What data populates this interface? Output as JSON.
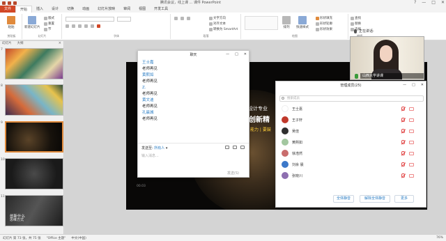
{
  "titlebar": {
    "title": "腾讯会议，线上课 ... 课件 PowerPoint",
    "controls": [
      "?",
      "—",
      "□",
      "✕"
    ]
  },
  "ribbon_tabs": [
    "文件",
    "开始",
    "插入",
    "设计",
    "切换",
    "动画",
    "幻灯片放映",
    "审阅",
    "视图",
    "开发工具"
  ],
  "ribbon": {
    "paste": "粘贴",
    "new_slide": "新建幻灯片",
    "layout": "版式",
    "reset": "重置",
    "section": "节",
    "text_direction": "文字方向",
    "align_text": "对齐文本",
    "smartart": "转换为 SmartArt",
    "arrange": "排列",
    "quick_styles": "快速样式",
    "shape_fill": "形状填充",
    "shape_outline": "形状轮廓",
    "shape_effects": "形状效果",
    "find": "查找",
    "replace": "替换",
    "select": "选择",
    "group_clipboard": "剪贴板",
    "group_slides": "幻灯片",
    "group_font": "字体",
    "group_paragraph": "段落",
    "group_drawing": "绘图",
    "group_editing": "编辑"
  },
  "left_panel": {
    "tabs": [
      "幻灯片",
      "大纲"
    ],
    "slide_numbers": [
      "7",
      "8",
      "9",
      "10",
      "11"
    ],
    "last_slide_title": "创新什么",
    "last_slide_sub": "思维方式"
  },
  "slide": {
    "line1": "设计专业",
    "line2": "创新精",
    "line3": "能力 | 要鼓",
    "small": "00.03"
  },
  "chat": {
    "title": "聊天",
    "messages": [
      {
        "name": "王士嘉",
        "text": "老师再见"
      },
      {
        "name": "黄熙如",
        "text": "老师再见"
      },
      {
        "name": "Z.",
        "text": "老师再见"
      },
      {
        "name": "黄文迪",
        "text": "老师再见"
      },
      {
        "name": "孔晨城",
        "text": "老师再见"
      }
    ],
    "send_to_label": "发送至:",
    "send_to_value": "所有人",
    "placeholder": "输入消息...",
    "send_button": "发送(S)"
  },
  "participants": {
    "title": "管理成员(25)",
    "search_placeholder": "搜索成员",
    "members": [
      {
        "name": "王士嘉",
        "color": "#ffffff"
      },
      {
        "name": "王子轩",
        "color": "#c0392b"
      },
      {
        "name": "吴佳",
        "color": "#2f2f2f"
      },
      {
        "name": "黄熙如",
        "color": "#a3c7a0"
      },
      {
        "name": "徐浩然",
        "color": "#c96d6d"
      },
      {
        "name": "刘余 晨",
        "color": "#3c78c9"
      },
      {
        "name": "张晓川",
        "color": "#8e6fb0"
      }
    ],
    "buttons": [
      "全体静音",
      "解除全体静音",
      "更多"
    ]
  },
  "video": {
    "speaker_label": "正在讲话:",
    "name": "山西大学讲课"
  },
  "status": {
    "slide": "幻灯片 第 73 张，共 75 张",
    "theme": "\"Office 主题\"",
    "lang": "中文(中国)",
    "zoom": "76%"
  }
}
